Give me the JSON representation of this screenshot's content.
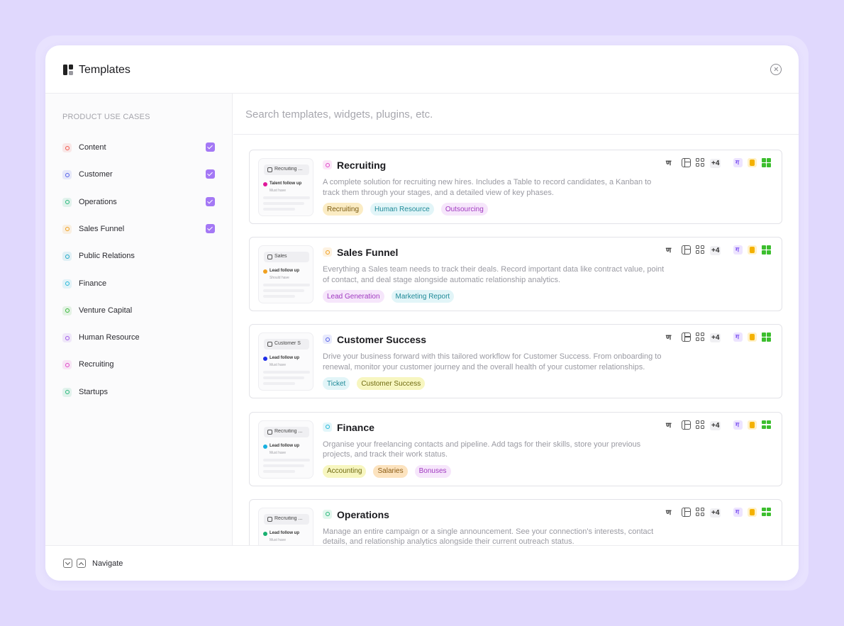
{
  "header": {
    "title": "Templates",
    "close_icon": "close-icon"
  },
  "sidebar": {
    "heading": "PRODUCT USE CASES",
    "items": [
      {
        "label": "Content",
        "checked": true,
        "color": "#f05a4f"
      },
      {
        "label": "Customer",
        "checked": true,
        "color": "#5662e8"
      },
      {
        "label": "Operations",
        "checked": true,
        "color": "#28b87a"
      },
      {
        "label": "Sales Funnel",
        "checked": true,
        "color": "#f0a020"
      },
      {
        "label": "Public Relations",
        "checked": false,
        "color": "#22a8c8"
      },
      {
        "label": "Finance",
        "checked": false,
        "color": "#26b8d8"
      },
      {
        "label": "Venture Capital",
        "checked": false,
        "color": "#38b838"
      },
      {
        "label": "Human Resource",
        "checked": false,
        "color": "#a05ae8"
      },
      {
        "label": "Recruiting",
        "checked": false,
        "color": "#e046c8"
      },
      {
        "label": "Startups",
        "checked": false,
        "color": "#2ab87a"
      }
    ]
  },
  "search": {
    "placeholder": "Search templates, widgets, plugins, etc."
  },
  "templates": [
    {
      "title": "Recruiting",
      "color": "#e046c8",
      "description": "A complete solution for recruiting new hires. Includes a Table to record candidates, a Kanban to track them through your stages, and a detailed view of key phases.",
      "tags": [
        {
          "label": "Recruiting",
          "style": "yellow"
        },
        {
          "label": "Human Resource",
          "style": "cyan"
        },
        {
          "label": "Outsourcing",
          "style": "purple"
        }
      ],
      "thumb": {
        "pill": "Recruiting ...",
        "line": "Talent follow up",
        "sub": "Must have",
        "dot": "#e0189a"
      },
      "more": "+4"
    },
    {
      "title": "Sales Funnel",
      "color": "#f0a020",
      "description": "Everything a Sales team needs to track their deals. Record important data like contract value, point of contact, and deal stage alongside automatic relationship analytics.",
      "tags": [
        {
          "label": "Lead Generation",
          "style": "purple"
        },
        {
          "label": "Marketing Report",
          "style": "cyan"
        }
      ],
      "thumb": {
        "pill": "Sales",
        "line": "Lead follow up",
        "sub": "Should have",
        "dot": "#f0a020"
      },
      "more": "+4"
    },
    {
      "title": "Customer Success",
      "color": "#5662e8",
      "description": "Drive your business forward with this tailored workflow for Customer Success. From onboarding to renewal, monitor your customer journey and the overall health of your customer relationships.",
      "tags": [
        {
          "label": "Ticket",
          "style": "cyan"
        },
        {
          "label": "Customer Success",
          "style": "lime"
        }
      ],
      "thumb": {
        "pill": "Customer S",
        "line": "Lead follow up",
        "sub": "Must have",
        "dot": "#1f2ee8"
      },
      "more": "+4"
    },
    {
      "title": "Finance",
      "color": "#26b8d8",
      "description": "Organise your freelancing contacts and pipeline. Add tags for their skills, store your previous projects, and track their work status.",
      "tags": [
        {
          "label": "Accounting",
          "style": "lime"
        },
        {
          "label": "Salaries",
          "style": "orange"
        },
        {
          "label": "Bonuses",
          "style": "purple"
        }
      ],
      "thumb": {
        "pill": "Recruiting ...",
        "line": "Lead follow up",
        "sub": "Must have",
        "dot": "#18b0e0"
      },
      "more": "+4"
    },
    {
      "title": "Operations",
      "color": "#28b87a",
      "description": "Manage an entire campaign or a single announcement. See your connection's interests, contact details, and relationship analytics alongside their current outreach status.",
      "tags": [],
      "thumb": {
        "pill": "Recruiting ...",
        "line": "Lead follow up",
        "sub": "Must have",
        "dot": "#18b070"
      },
      "more": "+4"
    }
  ],
  "footer": {
    "label": "Navigate"
  }
}
